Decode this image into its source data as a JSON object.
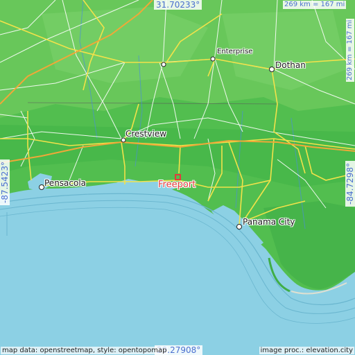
{
  "map": {
    "coords": {
      "top": "31.70233°",
      "bottom": "29.27908°",
      "left": "-87.5423°",
      "right": "-84.7298°"
    },
    "scale": {
      "horizontal": "269 km = 167 mi",
      "vertical": "269 km = 167 mi"
    },
    "focus_city": "Freeport",
    "cities": {
      "enterprise": "Enterprise",
      "dothan": "Dothan",
      "crestview": "Crestview",
      "pensacola": "Pensacola",
      "panama_city": "Panama City"
    },
    "attribution": {
      "left": "map data: openstreetmap, style: opentopomap",
      "right": "image proc.: elevation.city"
    },
    "colors": {
      "water": "#8cd0e4",
      "land": "#4fc04f",
      "focus": "#e23b3b",
      "coords_text": "#4a6fd0"
    }
  }
}
